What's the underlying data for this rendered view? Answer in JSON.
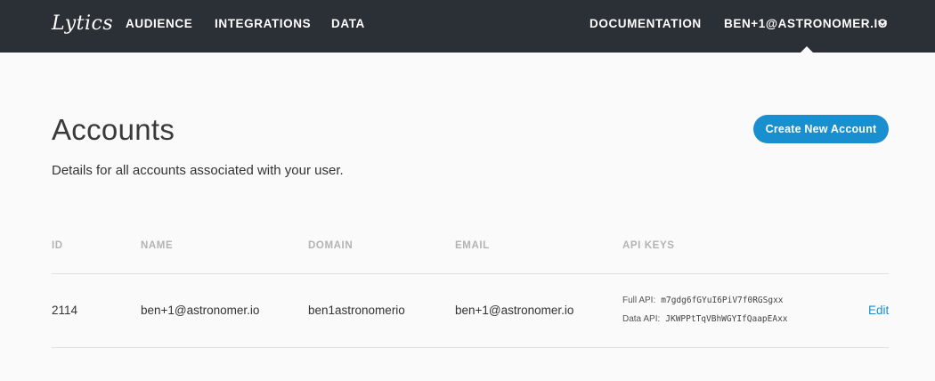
{
  "header": {
    "logo_text": "Lytics",
    "nav": {
      "audience": "AUDIENCE",
      "integrations": "INTEGRATIONS",
      "data": "DATA",
      "documentation": "DOCUMENTATION",
      "user": "BEN+1@ASTRONOMER.IO"
    },
    "user_menu_icon": "chevron-down-icon"
  },
  "main": {
    "title": "Accounts",
    "subtitle": "Details for all accounts associated with your user.",
    "create_button": "Create New Account"
  },
  "table": {
    "columns": {
      "id": "ID",
      "name": "NAME",
      "domain": "DOMAIN",
      "email": "EMAIL",
      "api_keys": "API KEYS"
    },
    "rows": [
      {
        "id": "2114",
        "name": "ben+1@astronomer.io",
        "domain": "ben1astronomerio",
        "email": "ben+1@astronomer.io",
        "full_api_label": "Full API:",
        "full_api_key": "m7gdg6fGYuI6PiV7f0RGSgxx",
        "data_api_label": "Data API:",
        "data_api_key": "JKWPPtTqVBhWGYIfQaapEAxx",
        "edit_label": "Edit"
      }
    ]
  },
  "colors": {
    "topbar": "#2b2f36",
    "accent": "#1a8fd0",
    "background": "#fafafa"
  }
}
